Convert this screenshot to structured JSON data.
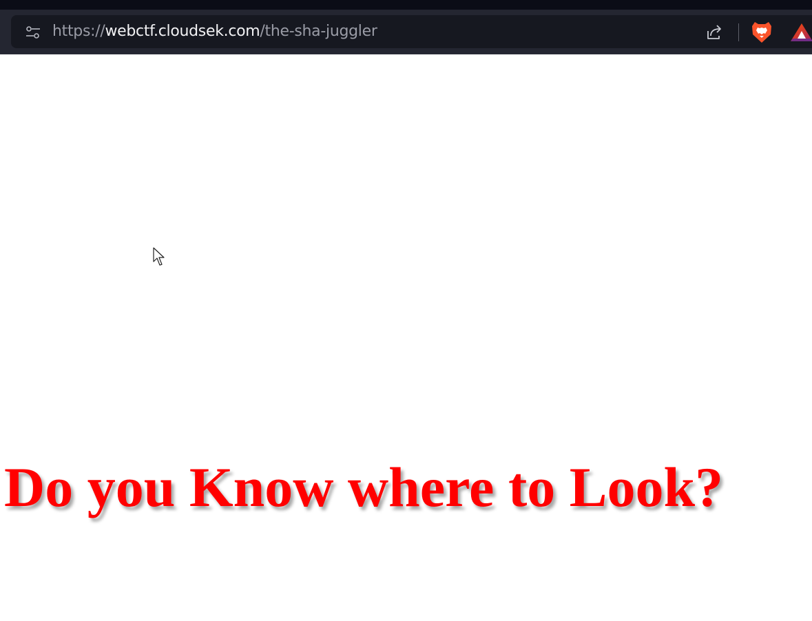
{
  "browser": {
    "url": {
      "scheme": "https://",
      "host": "webctf.cloudsek.com",
      "path": "/the-sha-juggler"
    },
    "icons": {
      "site_info": "site-settings-icon",
      "share": "share-icon",
      "brave": "brave-shields-icon",
      "rewards": "brave-rewards-icon"
    }
  },
  "page": {
    "headline": "Do you Know where to Look?",
    "headline_color": "#ff0000"
  },
  "colors": {
    "toolbar": "#242631",
    "omnibox": "#161820",
    "brave_orange": "#fb542b"
  }
}
